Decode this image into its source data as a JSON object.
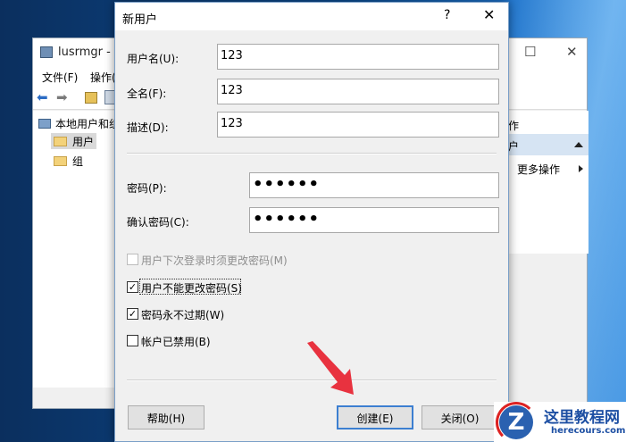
{
  "background_window": {
    "title": "lusrmgr - [",
    "controls": {
      "maximize": "☐",
      "close": "✕"
    },
    "menu": {
      "file": "文件(F)",
      "action": "操作("
    },
    "tree": [
      {
        "label": "本地用户和组"
      },
      {
        "label": "用户"
      },
      {
        "label": "组"
      }
    ],
    "actions_panel": {
      "header": "作",
      "subheader": "户",
      "more": "更多操作"
    }
  },
  "dialog": {
    "title": "新用户",
    "help_glyph": "?",
    "close_glyph": "✕",
    "fields": {
      "username": {
        "label": "用户名(U):",
        "value": "123"
      },
      "fullname": {
        "label": "全名(F):",
        "value": "123"
      },
      "description": {
        "label": "描述(D):",
        "value": "123"
      },
      "password": {
        "label": "密码(P):",
        "value": "••••••"
      },
      "confirm": {
        "label": "确认密码(C):",
        "value": "••••••"
      }
    },
    "checkboxes": {
      "must_change": {
        "label": "用户下次登录时须更改密码(M)",
        "checked": false,
        "disabled": true
      },
      "cannot_change": {
        "label": "用户不能更改密码(S)",
        "checked": true,
        "disabled": false
      },
      "never_expires": {
        "label": "密码永不过期(W)",
        "checked": true,
        "disabled": false
      },
      "disabled_account": {
        "label": "帐户已禁用(B)",
        "checked": false,
        "disabled": false
      }
    },
    "buttons": {
      "help": "帮助(H)",
      "create": "创建(E)",
      "close": "关闭(O)"
    }
  },
  "watermark": {
    "letter": "Z",
    "cn": "这里教程网",
    "en": "herecours.com"
  },
  "colors": {
    "arrow": "#e8323f",
    "default_button_border": "#3c7fd1",
    "dialog_border": "#7a9fc8"
  }
}
